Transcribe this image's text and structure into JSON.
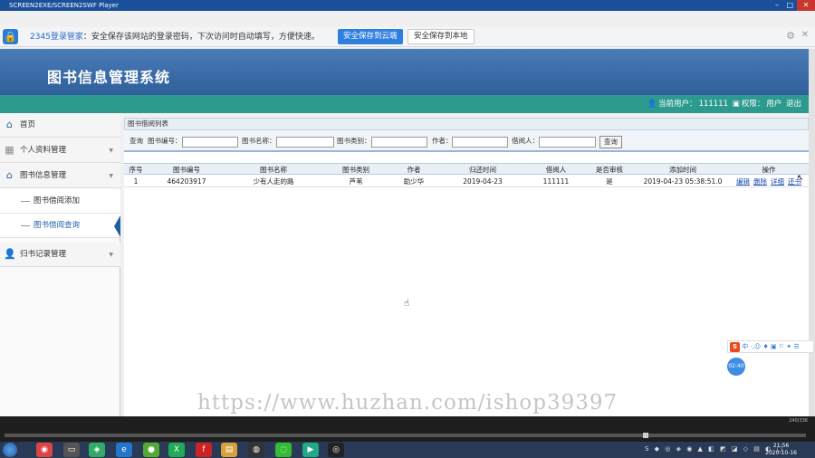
{
  "player": {
    "title": "SCREEN2EXE/SCREEN2SWF Player",
    "min": "–",
    "max": "□",
    "close": "✕",
    "time": "240/336"
  },
  "password_bar": {
    "brand": "2345登录管家",
    "message": "：安全保存该网站的登录密码，下次访问时自动填写，方便快速。",
    "save_cloud": "安全保存到云端",
    "save_local": "安全保存到本地"
  },
  "header": {
    "title": "图书信息管理系统",
    "current_user_label": "当前用户：",
    "current_user": "111111",
    "role_label": "权限：",
    "role": "用户",
    "logout": "退出"
  },
  "sidebar": {
    "home": "首页",
    "personal": "个人资料管理",
    "book_info": "图书信息管理",
    "book_borrow_add": "图书借阅添加",
    "book_borrow_query": "图书借阅查询",
    "return_records": "归书记录管理"
  },
  "panel": {
    "title": "图书借阅列表"
  },
  "search": {
    "query_label": "查询",
    "book_no_label": "图书编号：",
    "book_name_label": "图书名称：",
    "book_type_label": "图书类别：",
    "author_label": "作者：",
    "borrower_label": "借阅人：",
    "submit": "查询"
  },
  "table": {
    "headers": [
      "序号",
      "图书编号",
      "图书名称",
      "图书类别",
      "作者",
      "归还时间",
      "借阅人",
      "是否审核",
      "添加时间",
      "操作"
    ],
    "rows": [
      {
        "index": "1",
        "book_no": "464203917",
        "book_name": "少有人走的路",
        "book_type": "芦苇",
        "author": "助少华",
        "return_time": "2019-04-23",
        "borrower": "111111",
        "audited": "是",
        "added_time": "2019-04-23 05:38:51.0",
        "actions": [
          "编辑",
          "删除",
          "详细",
          "还书"
        ]
      }
    ]
  },
  "watermark": "https://www.huzhan.com/ishop39397",
  "ime": {
    "logo": "S",
    "mode": "中",
    "icons": "·,☺ ♦ ▣ ⚐ ✦ ☰"
  },
  "timer": "02:40",
  "taskbar": {
    "time": "21:56",
    "date": "2020-10-16",
    "tray_icons": "S ◆ ◎ ◈ ◉ ▲ ◧ ◩ ◪ ◇ ▤ ◐ ▢"
  }
}
